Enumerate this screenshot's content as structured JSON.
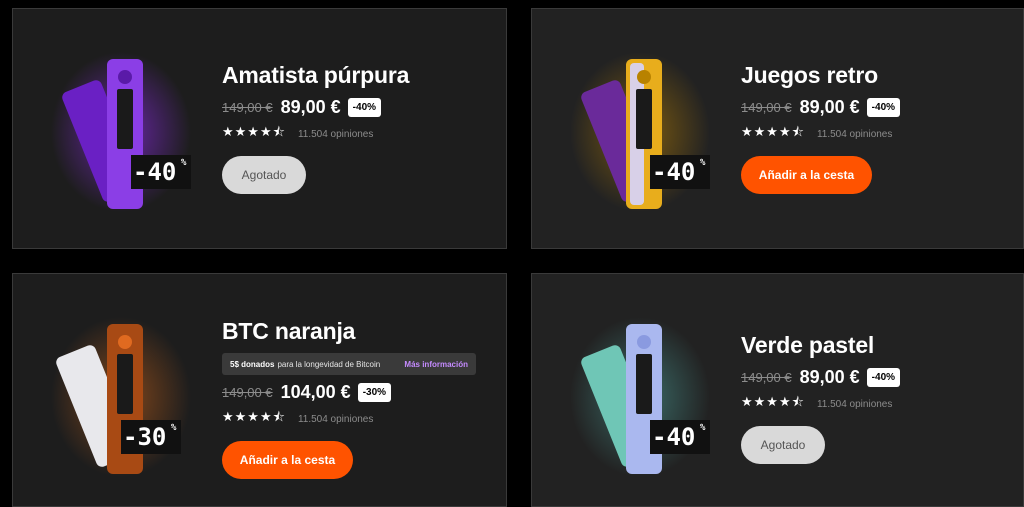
{
  "products": [
    {
      "title": "Amatista púrpura",
      "old_price": "149,00 €",
      "price": "89,00 €",
      "discount": "-40%",
      "stars": "★★★★⯪",
      "reviews": "11.504 opiniones",
      "button": "Agotado",
      "image_badge": "-40%",
      "colors": {
        "device": "#7a2ed6",
        "glow": "#8a2be2",
        "screen": "#1a1a1a"
      }
    },
    {
      "title": "Juegos retro",
      "old_price": "149,00 €",
      "price": "89,00 €",
      "discount": "-40%",
      "stars": "★★★★⯪",
      "reviews": "11.504 opiniones",
      "button": "Añadir a la cesta",
      "image_badge": "-40%",
      "colors": {
        "device": "#e8ad1c",
        "glow": "#c88a00",
        "screen": "#1a1a1a"
      }
    },
    {
      "title": "BTC naranja",
      "promo": {
        "bold": "5$ donados",
        "text": "para la longevidad de Bitcoin",
        "link": "Más información"
      },
      "old_price": "149,00 €",
      "price": "104,00 €",
      "discount": "-30%",
      "stars": "★★★★⯪",
      "reviews": "11.504 opiniones",
      "button": "Añadir a la cesta",
      "image_badge": "-30%",
      "colors": {
        "device": "#b8561a",
        "glow": "#ff7a1a",
        "screen": "#1a1a1a"
      }
    },
    {
      "title": "Verde pastel",
      "old_price": "149,00 €",
      "price": "89,00 €",
      "discount": "-40%",
      "stars": "★★★★⯪",
      "reviews": "11.504 opiniones",
      "button": "Agotado",
      "image_badge": "-40%",
      "colors": {
        "device": "#aab8ef",
        "glow": "#5ac8c0",
        "screen": "#1a1a1a"
      }
    }
  ],
  "colors": {
    "accent": "#ff5300",
    "sold_out": "#d9d9d9",
    "card_bg": "#1d1d1d"
  }
}
